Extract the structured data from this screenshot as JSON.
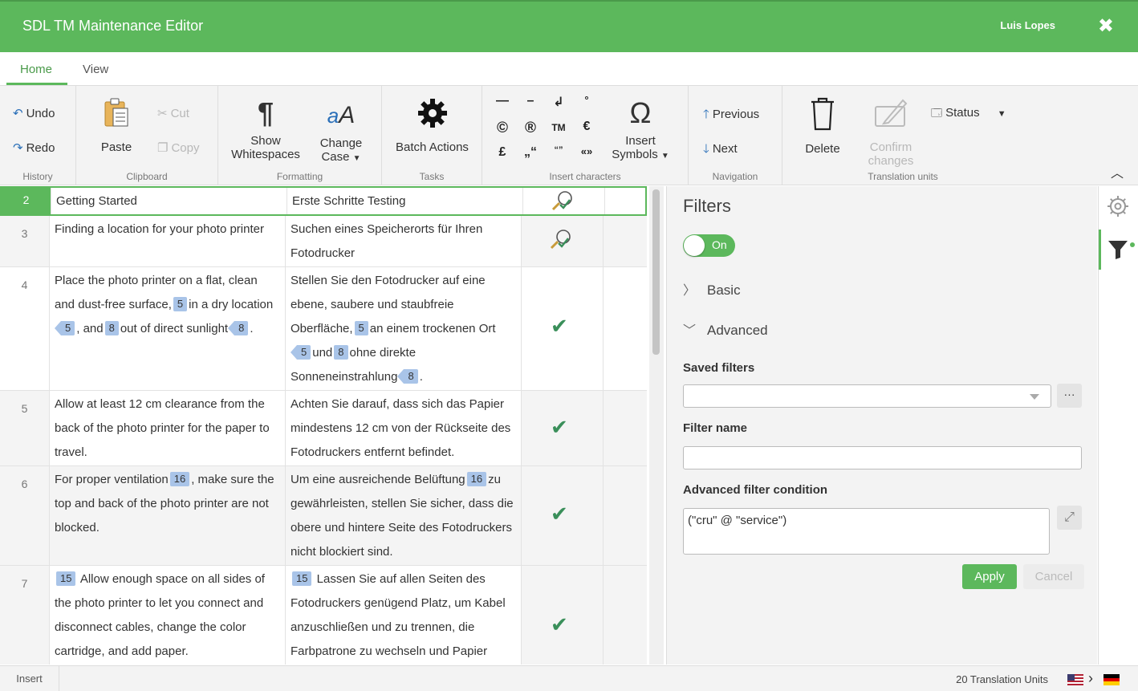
{
  "titlebar": {
    "title": "SDL TM Maintenance Editor",
    "user": "Luis Lopes",
    "close_glyph": "✖"
  },
  "tabs": [
    {
      "label": "Home",
      "active": true
    },
    {
      "label": "View",
      "active": false
    }
  ],
  "ribbon": {
    "history": {
      "label": "History",
      "undo": "Undo",
      "redo": "Redo"
    },
    "clipboard": {
      "label": "Clipboard",
      "paste": "Paste",
      "cut": "Cut",
      "copy": "Copy"
    },
    "formatting": {
      "label": "Formatting",
      "show_ws_1": "Show",
      "show_ws_2": "Whitespaces",
      "change_case_1": "Change",
      "change_case_2": "Case"
    },
    "tasks": {
      "label": "Tasks",
      "batch": "Batch Actions"
    },
    "insert_chars": {
      "label": "Insert characters",
      "symbols": [
        "—",
        "–",
        "↲",
        "°",
        "©",
        "®",
        "TM",
        "€",
        "£",
        "„“",
        "“”",
        "«»"
      ],
      "insert_symbols_1": "Insert",
      "insert_symbols_2": "Symbols"
    },
    "navigation": {
      "label": "Navigation",
      "previous": "Previous",
      "next": "Next"
    },
    "tu": {
      "label": "Translation units",
      "delete": "Delete",
      "confirm_1": "Confirm",
      "confirm_2": "changes",
      "status": "Status"
    }
  },
  "rows": [
    {
      "num": "2",
      "src": "Getting Started",
      "tgt": "Erste Schritte Testing",
      "status": "review"
    },
    {
      "num": "3",
      "src": "Finding a location for your photo printer",
      "tgt": "Suchen eines Speicherorts für Ihren Fotodrucker",
      "status": "review"
    },
    {
      "num": "4",
      "src_parts": [
        "Place the photo printer on a flat, clean and dust-free surface,",
        "5",
        "in a dry location",
        "5",
        ", and",
        "8",
        "out of direct sunlight",
        "8",
        "."
      ],
      "tgt_parts": [
        "Stellen Sie den Fotodrucker auf eine ebene, saubere und staubfreie Oberfläche,",
        "5",
        "an einem trockenen Ort",
        "5",
        "und",
        "8",
        "ohne direkte Sonneneinstrahlung",
        "8",
        "."
      ],
      "status": "confirmed"
    },
    {
      "num": "5",
      "src": "Allow at least 12 cm clearance from the back of the photo printer for the paper to travel.",
      "tgt": "Achten Sie darauf, dass sich das Papier mindestens 12 cm von der Rückseite des Fotodruckers entfernt befindet.",
      "status": "confirmed"
    },
    {
      "num": "6",
      "src_parts": [
        "For proper ventilation",
        "16",
        ", make sure the top and back of the photo printer are not blocked."
      ],
      "tgt_parts": [
        "Um eine ausreichende Belüftung",
        "16",
        "zu gewährleisten, stellen Sie sicher, dass die obere und hintere Seite des Fotodruckers nicht blockiert sind."
      ],
      "status": "confirmed"
    },
    {
      "num": "7",
      "src_parts": [
        "15",
        "Allow enough space on all sides of the photo printer to let you connect and disconnect cables, change the color cartridge, and add paper."
      ],
      "tgt_parts": [
        "15",
        "Lassen Sie auf allen Seiten des Fotodruckers genügend Platz, um Kabel anzuschließen und zu trennen, die Farbpatrone zu wechseln und Papier"
      ],
      "status": "confirmed"
    }
  ],
  "filters": {
    "title": "Filters",
    "toggle_label": "On",
    "basic": "Basic",
    "advanced": "Advanced",
    "saved_filters_label": "Saved filters",
    "saved_filters_value": "",
    "more_glyph": "···",
    "filter_name_label": "Filter name",
    "filter_name_value": "",
    "condition_label": "Advanced filter condition",
    "condition_value": "(\"cru\" @ \"service\")",
    "apply": "Apply",
    "cancel": "Cancel"
  },
  "statusbar": {
    "mode": "Insert",
    "count": "20 Translation Units",
    "source_lang": "en-US",
    "target_lang": "de-DE"
  },
  "colors": {
    "accent": "#5cb85c",
    "tag": "#a9c4e8",
    "check": "#3a8f5a"
  }
}
